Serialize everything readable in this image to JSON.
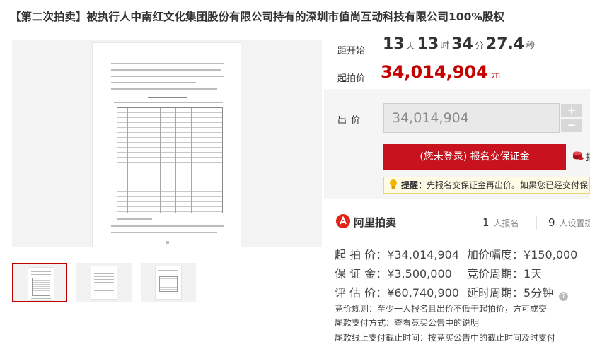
{
  "title": "【第二次拍卖】被执行人中南红文化集团股份有限公司持有的深圳市值尚互动科技有限公司100%股权",
  "countdown": {
    "label": "距开始",
    "days": "13",
    "days_unit": "天",
    "hours": "13",
    "hours_unit": "时",
    "minutes": "34",
    "minutes_unit": "分",
    "seconds": "27.4",
    "seconds_unit": "秒"
  },
  "start_price": {
    "label": "起拍价",
    "value": "34,014,904",
    "unit": "元"
  },
  "bid": {
    "label": "出价",
    "value": "34,014,904",
    "plus": "+",
    "minus": "−",
    "signup_button": "(您未登录) 报名交保证金",
    "edge_text": "指",
    "tip_bold": "提醒：",
    "tip_text": "先报名交保证金再出价。如果您已经交付保证"
  },
  "brand": {
    "name": "阿里拍卖",
    "signups_count": "1",
    "signups_unit": "人报名",
    "reminders_count": "9",
    "reminders_unit": "人设置提"
  },
  "info": {
    "left": [
      {
        "key": "起 拍 价：",
        "value": "¥34,014,904"
      },
      {
        "key": "保 证 金：",
        "value": "¥3,500,000"
      },
      {
        "key": "评 估 价：",
        "value": "¥60,740,900"
      }
    ],
    "right": [
      {
        "key": "加价幅度：",
        "value": "¥150,000"
      },
      {
        "key": "竞价周期：",
        "value": "1天"
      },
      {
        "key": "延时周期：",
        "value": "5分钟"
      }
    ]
  },
  "rules": [
    {
      "key": "竞价规则：",
      "value": "至少一人报名且出价不低于起拍价，方可成交"
    },
    {
      "key": "尾款支付方式：",
      "value": "查看竞买公告中的说明"
    },
    {
      "key": "尾款线上支付截止时间：",
      "value": "按竞买公告中的截止时间及时支付"
    }
  ],
  "colors": {
    "accent": "#c40000",
    "button": "#c8131e",
    "tip_bg": "#fffbe4"
  },
  "icons": {
    "tip": "bulb-icon",
    "deposit": "coins-icon",
    "brand": "ali-auction-logo",
    "help": "question-icon"
  }
}
